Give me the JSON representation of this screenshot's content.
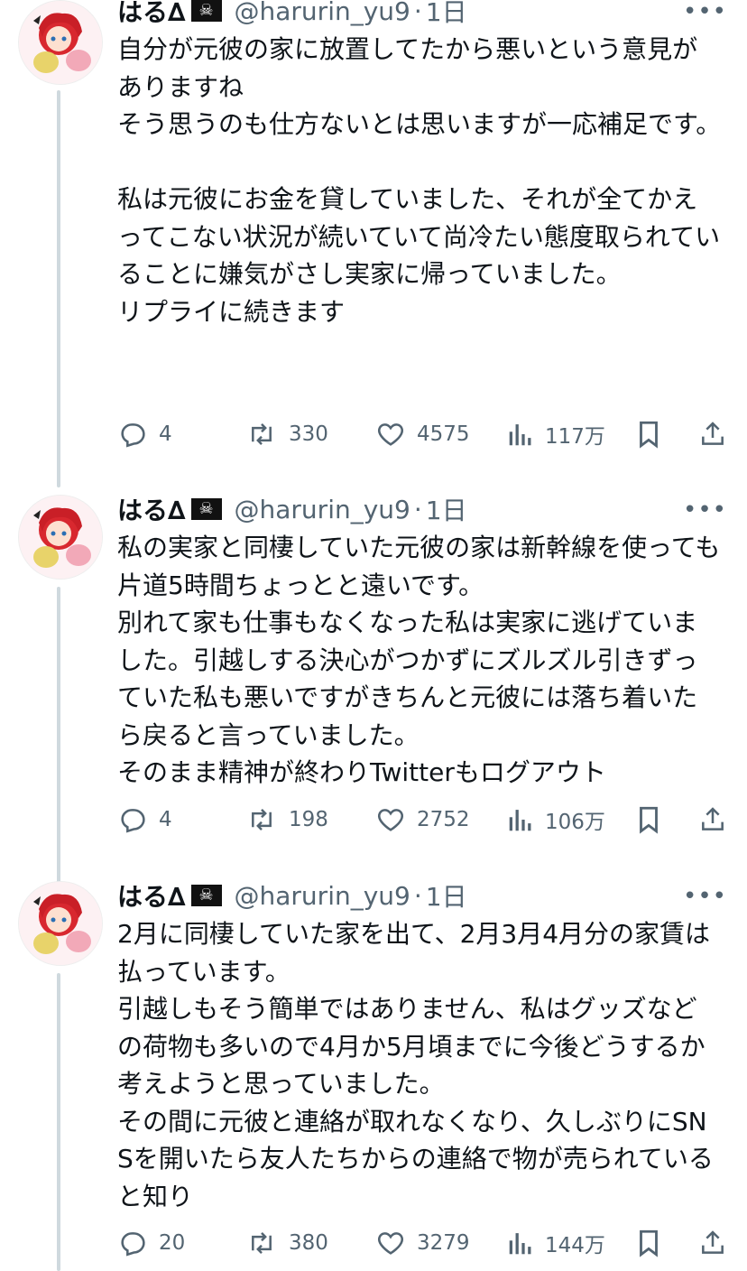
{
  "tweets": [
    {
      "name": "はる∆",
      "handle": "@harurin_yu9",
      "separator": "·",
      "time": "1日",
      "more": "•••",
      "text": "自分が元彼の家に放置してたから悪いという意見がありますね\nそう思うのも仕方ないとは思いますが一応補足です。\n\n私は元彼にお金を貸していました、それが全てかえってこない状況が続いていて尚冷たい態度取られていることに嫌気がさし実家に帰っていました。\nリプライに続きます",
      "replies": "4",
      "retweets": "330",
      "likes": "4575",
      "views": "117万"
    },
    {
      "name": "はる∆",
      "handle": "@harurin_yu9",
      "separator": "·",
      "time": "1日",
      "more": "•••",
      "text": "私の実家と同棲していた元彼の家は新幹線を使っても片道5時間ちょっとと遠いです。\n別れて家も仕事もなくなった私は実家に逃げていました。引越しする決心がつかずにズルズル引きずっていた私も悪いですがきちんと元彼には落ち着いたら戻ると言っていました。\nそのまま精神が終わりTwitterもログアウト",
      "replies": "4",
      "retweets": "198",
      "likes": "2752",
      "views": "106万"
    },
    {
      "name": "はる∆",
      "handle": "@harurin_yu9",
      "separator": "·",
      "time": "1日",
      "more": "•••",
      "text": "2月に同棲していた家を出て、2月3月4月分の家賃は払っています。\n引越しもそう簡単ではありません、私はグッズなどの荷物も多いので4月か5月頃までに今後どうするか考えようと思っていました。\nその間に元彼と連絡が取れなくなり、久しぶりにSNSを開いたら友人たちからの連絡で物が売られていると知り",
      "replies": "20",
      "retweets": "380",
      "likes": "3279",
      "views": "144万"
    }
  ],
  "icons": {
    "flag": "pirate-flag-icon",
    "reply": "reply-icon",
    "retweet": "retweet-icon",
    "like": "heart-icon",
    "views": "views-icon",
    "bookmark": "bookmark-icon",
    "share": "share-icon"
  },
  "colors": {
    "text": "#0f1419",
    "secondary": "#536471",
    "thread_line": "#cfd9de",
    "avatar_hair": "#d8282f"
  }
}
